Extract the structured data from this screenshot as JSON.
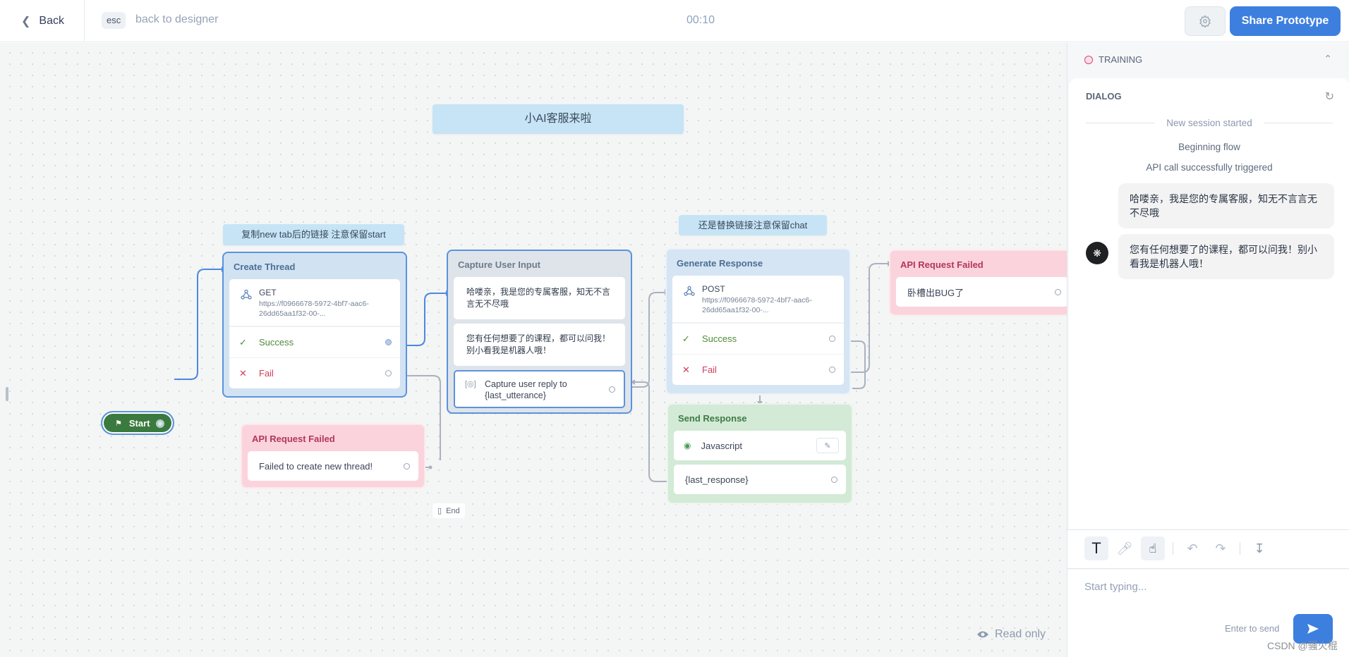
{
  "header": {
    "back_label": "Back",
    "esc_key": "esc",
    "back_hint": "back to designer",
    "timer": "00:10",
    "settings_icon": "gear-icon",
    "share_label": "Share Prototype"
  },
  "canvas": {
    "title_note": "小AI客服来啦",
    "note_create": "复制new tab后的链接 注意保留start",
    "note_generate": "还是替换链接注意保留chat",
    "start_label": "Start",
    "create_thread": {
      "title": "Create Thread",
      "method": "GET",
      "url": "https://f0966678-5972-4bf7-aac6-26dd65aa1f32-00-...",
      "success": "Success",
      "fail": "Fail"
    },
    "api_failed_1": {
      "title": "API Request Failed",
      "message": "Failed to create new thread!"
    },
    "end_label": "End",
    "capture": {
      "title": "Capture User Input",
      "messages": [
        "哈喽亲，我是您的专属客服，知无不言言无不尽哦",
        "您有任何想要了的课程，都可以问我！别小看我是机器人哦！"
      ],
      "capture_text": "Capture user reply to {last_utterance}"
    },
    "generate": {
      "title": "Generate Response",
      "method": "POST",
      "url": "https://f0966678-5972-4bf7-aac6-26dd65aa1f32-00-...",
      "success": "Success",
      "fail": "Fail"
    },
    "send": {
      "title": "Send Response",
      "script_label": "Javascript",
      "response_var": "{last_response}"
    },
    "api_failed_2": {
      "title": "API Request Failed",
      "message": "卧槽出BUG了"
    },
    "read_only": "Read only"
  },
  "panel": {
    "training_label": "TRAINING",
    "dialog_title": "DIALOG",
    "session_divider": "New session started",
    "system_lines": [
      "Beginning flow",
      "API call successfully triggered"
    ],
    "messages": [
      {
        "from": "bot",
        "text": "哈喽亲，我是您的专属客服，知无不言言无不尽哦"
      },
      {
        "from": "bot",
        "text": "您有任何想要了的课程，都可以问我！别小看我是机器人哦！"
      }
    ],
    "toolbar": [
      "text-mode-icon",
      "microphone-icon",
      "tap-button-icon",
      "undo-icon",
      "redo-icon",
      "download-chat-icon"
    ],
    "input_placeholder": "Start typing...",
    "enter_hint": "Enter to send"
  },
  "watermark": "CSDN @骚火棍",
  "colors": {
    "accent": "#3d7fdf",
    "start_green": "#3a7a3e",
    "fail_red": "#d13c5b",
    "success_green": "#4f8a3a",
    "note_blue": "#c6e4f5"
  }
}
